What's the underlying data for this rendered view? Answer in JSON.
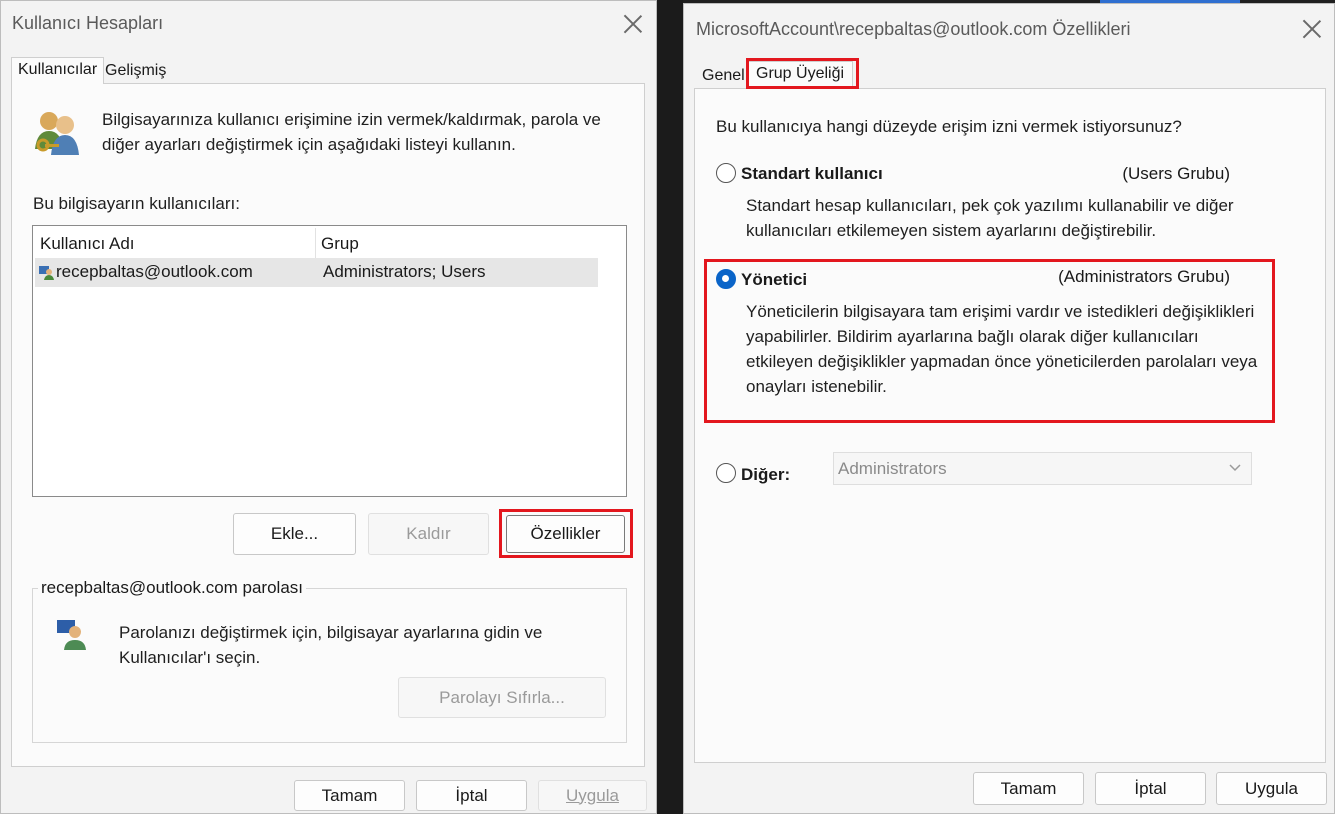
{
  "left_dialog": {
    "title": "Kullanıcı Hesapları",
    "tabs": [
      "Kullanıcılar",
      "Gelişmiş"
    ],
    "intro_text": "Bilgisayarınıza kullanıcı erişimine izin vermek/kaldırmak, parola ve diğer ayarları değiştirmek için aşağıdaki listeyi kullanın.",
    "users_label": "Bu bilgisayarın kullanıcıları:",
    "columns": [
      "Kullanıcı Adı",
      "Grup"
    ],
    "rows": [
      {
        "user": "recepbaltas@outlook.com",
        "group": "Administrators; Users"
      }
    ],
    "buttons": {
      "add": "Ekle...",
      "remove": "Kaldır",
      "properties": "Özellikler"
    },
    "password_group_title": "recepbaltas@outlook.com parolası",
    "password_text": "Parolanızı değiştirmek için, bilgisayar ayarlarına gidin ve Kullanıcılar'ı seçin.",
    "reset_button": "Parolayı Sıfırla...",
    "footer": {
      "ok": "Tamam",
      "cancel": "İptal",
      "apply": "Uygula"
    }
  },
  "right_dialog": {
    "title": "MicrosoftAccount\\recepbaltas@outlook.com Özellikleri",
    "tabs": [
      "Genel",
      "Grup Üyeliği"
    ],
    "question": "Bu kullanıcıya hangi düzeyde erişim izni vermek istiyorsunuz?",
    "standard": {
      "label": "Standart kullanıcı",
      "group": "(Users Grubu)",
      "description": "Standart hesap kullanıcıları, pek çok yazılımı kullanabilir ve diğer kullanıcıları etkilemeyen sistem ayarlarını değiştirebilir."
    },
    "admin": {
      "label": "Yönetici",
      "group": "(Administrators Grubu)",
      "description": "Yöneticilerin bilgisayara tam erişimi vardır ve istedikleri değişiklikleri yapabilirler. Bildirim ayarlarına bağlı olarak diğer kullanıcıları etkileyen değişiklikler yapmadan önce yöneticilerden parolaları veya onayları istenebilir."
    },
    "other": {
      "label": "Diğer:",
      "value": "Administrators"
    },
    "selected": "admin",
    "footer": {
      "ok": "Tamam",
      "cancel": "İptal",
      "apply": "Uygula"
    }
  },
  "colors": {
    "highlight": "#e3171e",
    "radio_selected": "#0a64c8"
  }
}
